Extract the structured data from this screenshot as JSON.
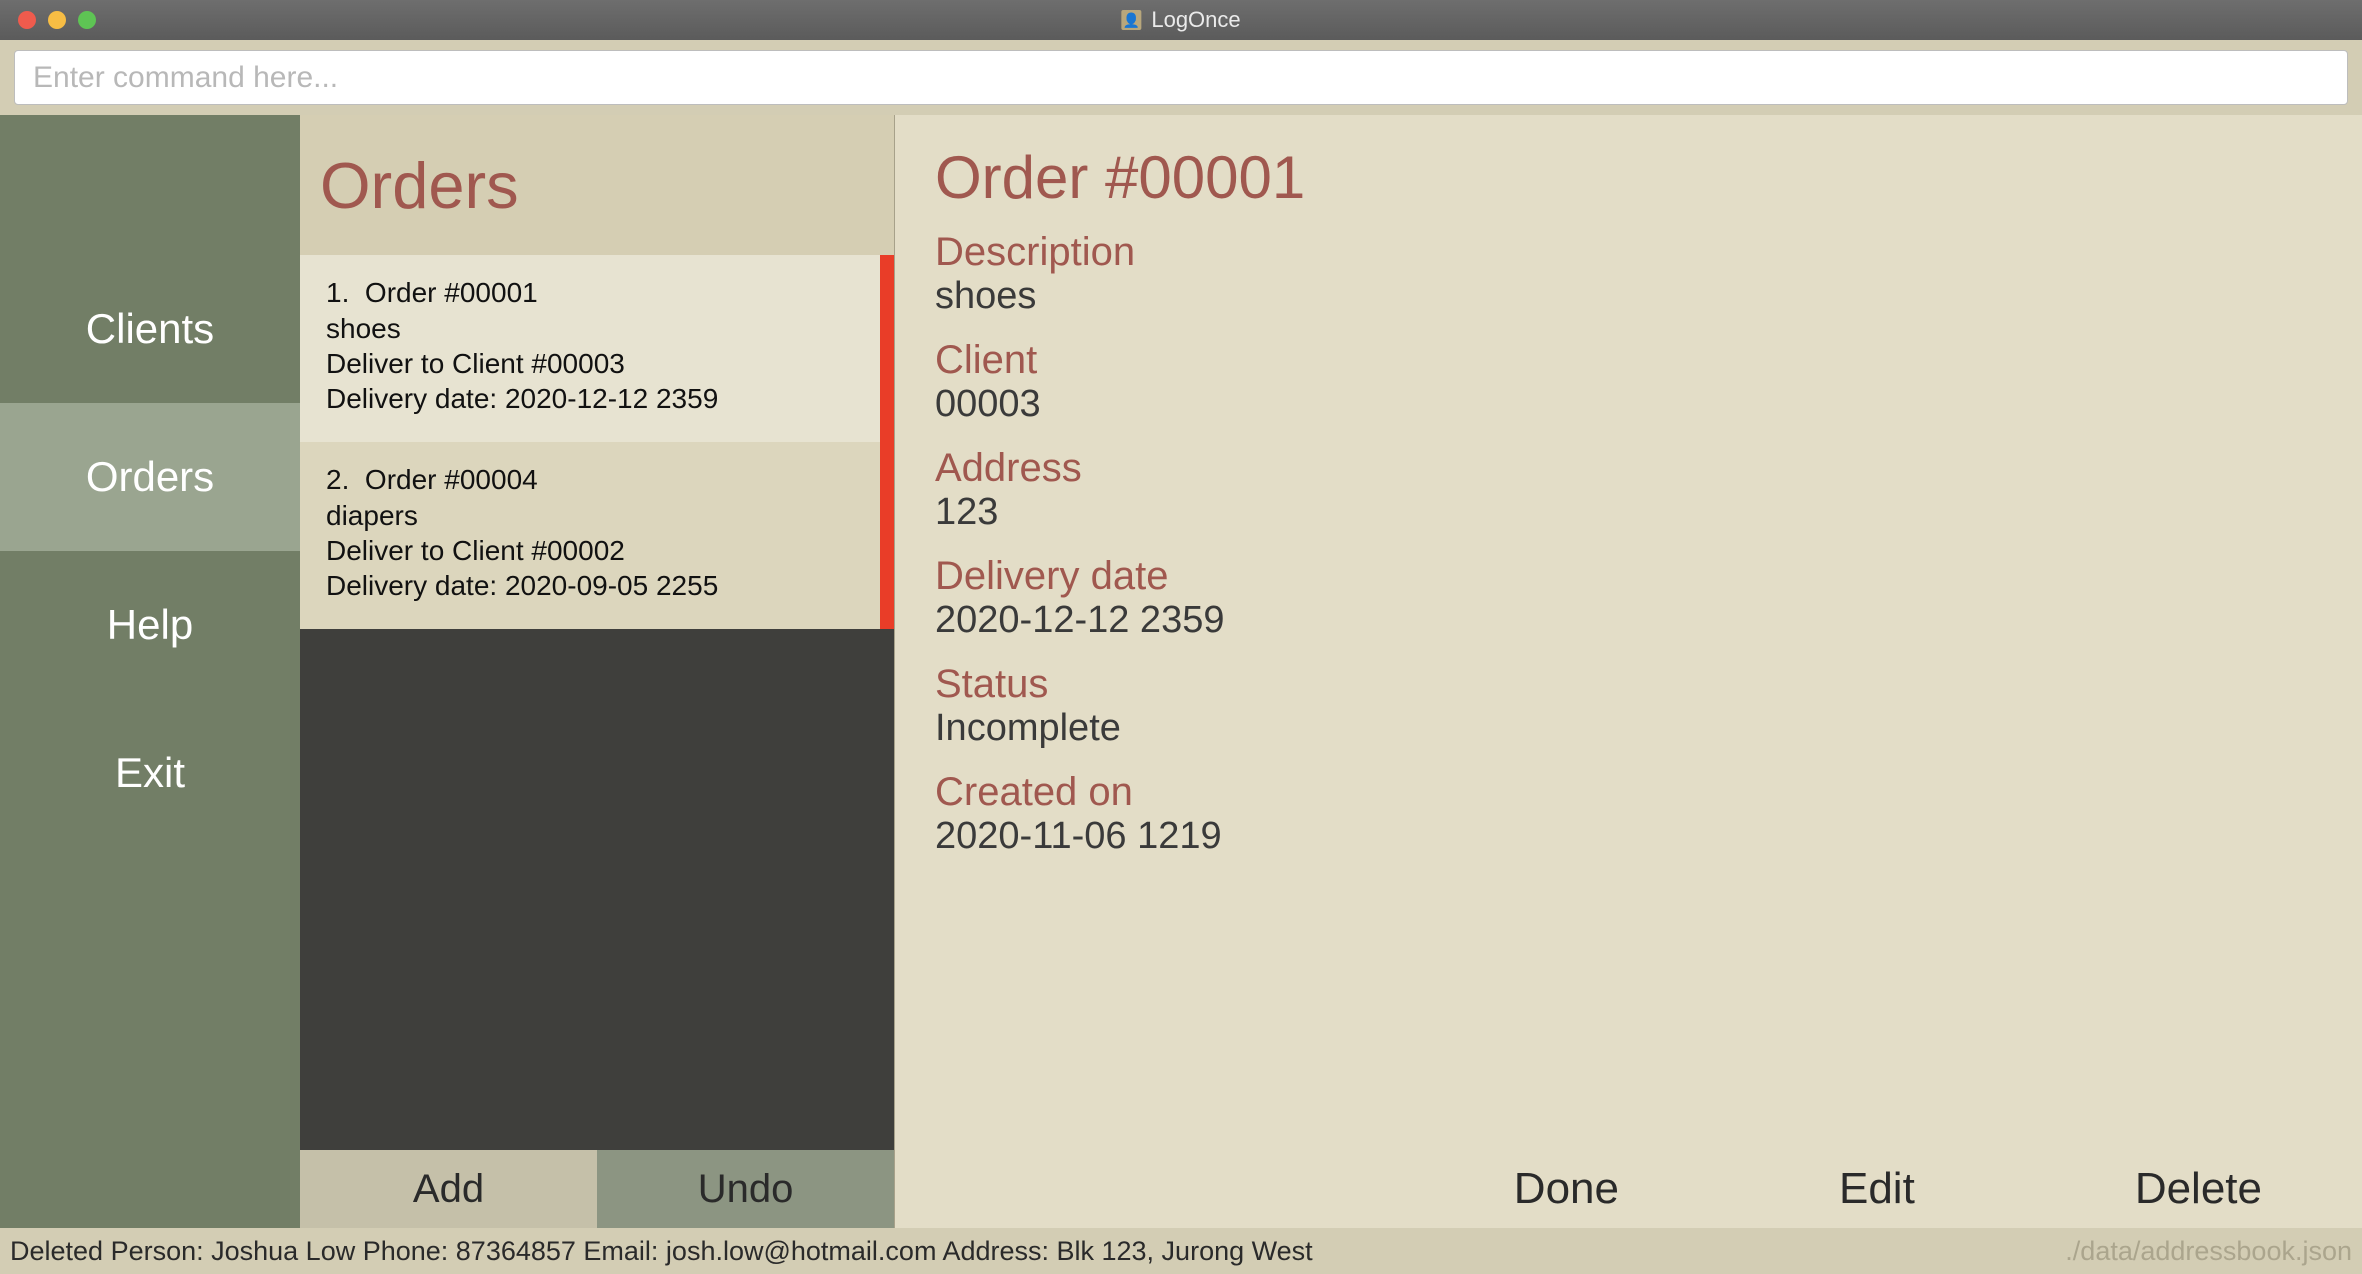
{
  "window": {
    "title": "LogOnce"
  },
  "traffic": {
    "close": "#ef5b4d",
    "min": "#f7bd44",
    "max": "#5ec454"
  },
  "command": {
    "placeholder": "Enter command here..."
  },
  "sidebar": {
    "items": [
      {
        "label": "Clients",
        "active": false
      },
      {
        "label": "Orders",
        "active": true
      },
      {
        "label": "Help",
        "active": false
      },
      {
        "label": "Exit",
        "active": false
      }
    ]
  },
  "list": {
    "title": "Orders",
    "buttons": {
      "add": "Add",
      "undo": "Undo"
    },
    "items": [
      {
        "index": "1.",
        "name": "Order #00001",
        "desc": "shoes",
        "client": "Deliver to Client #00003",
        "date": "Delivery date: 2020-12-12 2359"
      },
      {
        "index": "2.",
        "name": "Order #00004",
        "desc": "diapers",
        "client": "Deliver to Client #00002",
        "date": "Delivery date: 2020-09-05 2255"
      }
    ]
  },
  "detail": {
    "title": "Order #00001",
    "fields": {
      "description_label": "Description",
      "description_value": "shoes",
      "client_label": "Client",
      "client_value": "00003",
      "address_label": "Address",
      "address_value": "123",
      "delivery_label": "Delivery date",
      "delivery_value": "2020-12-12 2359",
      "status_label": "Status",
      "status_value": "Incomplete",
      "created_label": "Created on",
      "created_value": "2020-11-06 1219"
    },
    "actions": {
      "done": "Done",
      "edit": "Edit",
      "delete": "Delete"
    }
  },
  "statusbar": {
    "message": "Deleted Person: Joshua Low Phone: 87364857 Email: josh.low@hotmail.com Address: Blk 123, Jurong West",
    "path": "./data/addressbook.json"
  }
}
